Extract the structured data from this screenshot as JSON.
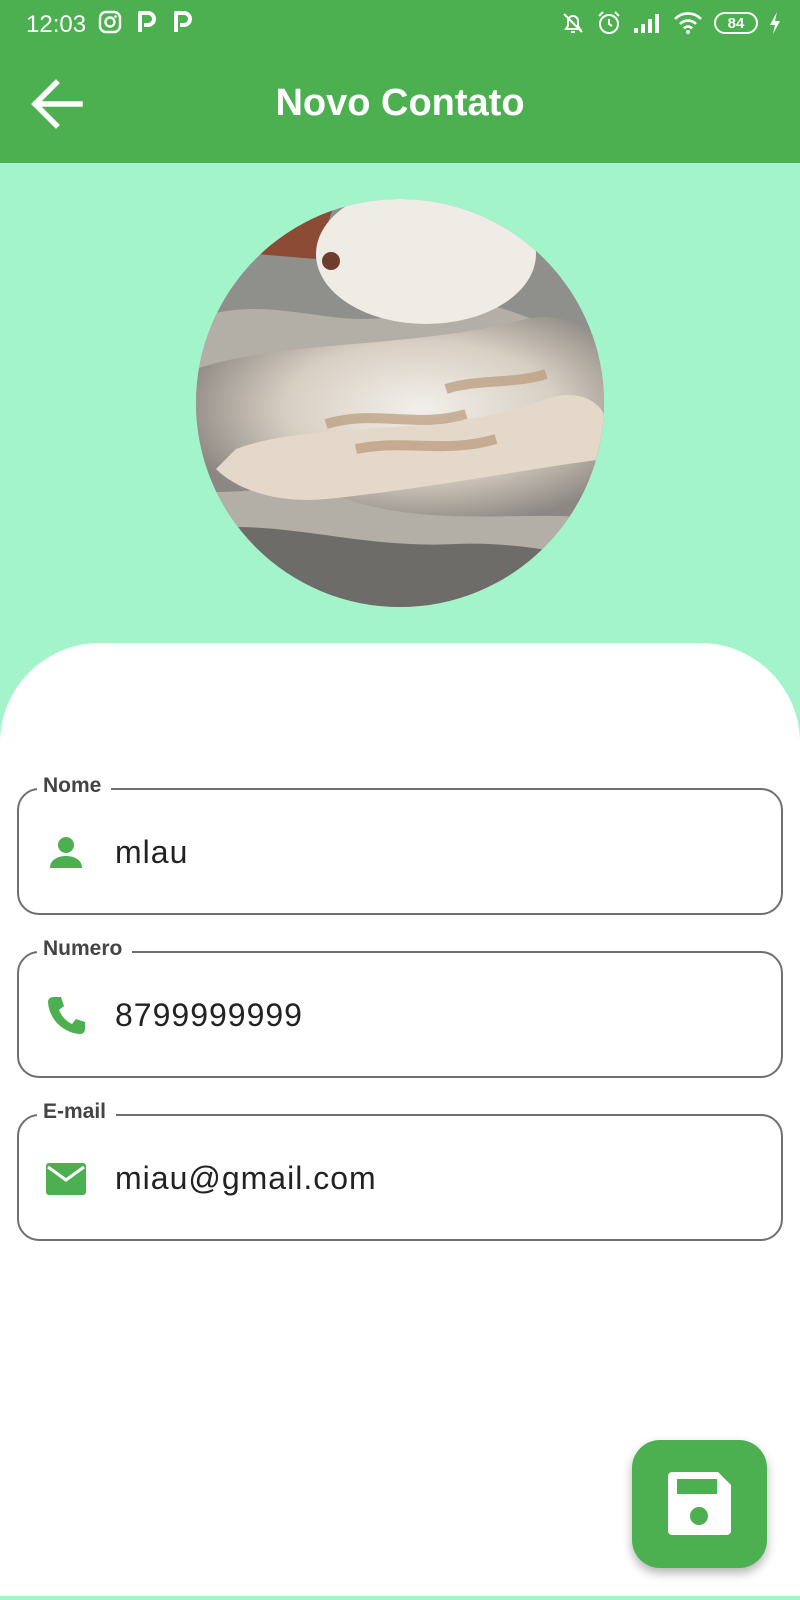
{
  "status_bar": {
    "time": "12:03",
    "battery": "84",
    "icons": [
      "instagram-icon",
      "p-icon",
      "p-icon",
      "bell-off-icon",
      "alarm-icon",
      "signal-icon",
      "wifi-icon",
      "battery-icon",
      "charging-icon"
    ]
  },
  "app_bar": {
    "title": "Novo Contato",
    "back_icon": "arrow-back-icon"
  },
  "avatar": {
    "icon": "contact-photo"
  },
  "form": {
    "nome": {
      "label": "Nome",
      "value": "mlau",
      "icon": "person-icon"
    },
    "numero": {
      "label": "Numero",
      "value": "8799999999",
      "icon": "phone-icon"
    },
    "email": {
      "label": "E-mail",
      "value": "miau@gmail.com",
      "icon": "email-icon"
    }
  },
  "fab": {
    "icon": "save-icon"
  },
  "colors": {
    "primary": "#4caf50",
    "header_background": "#a4f4cb",
    "card_background": "#ffffff",
    "field_border": "#6f6f6f"
  }
}
